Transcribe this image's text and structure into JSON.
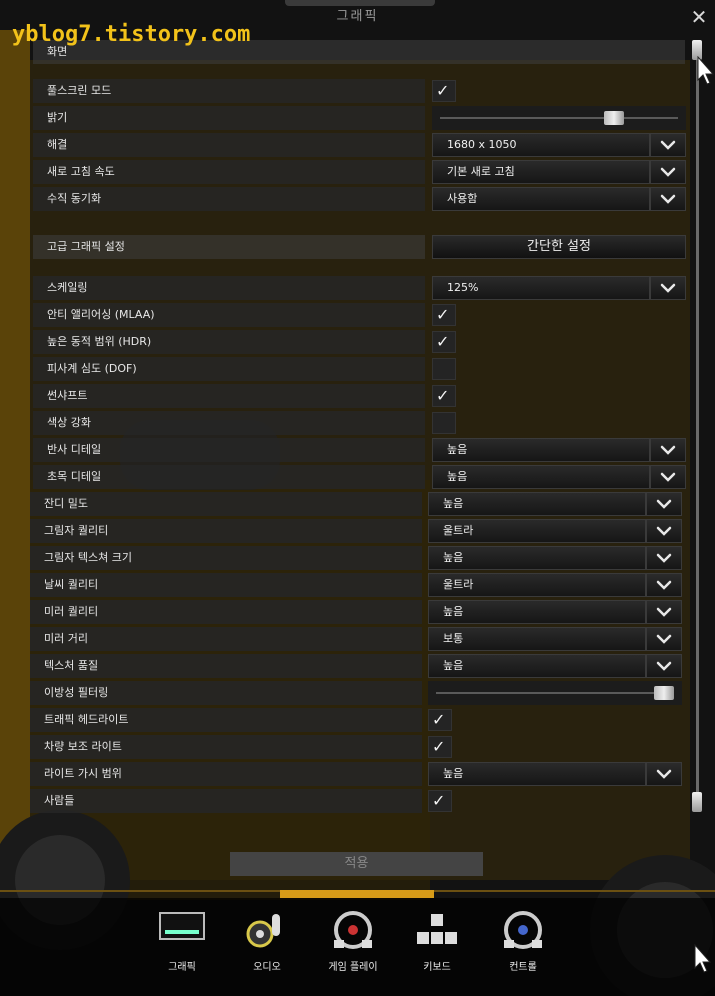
{
  "window": {
    "title": "그래픽",
    "close_glyph": "✕",
    "watermark": "yblog7.tistory.com"
  },
  "sections": {
    "screen": "화면",
    "advanced": "고급 그래픽 설정",
    "simple_button": "간단한 설정"
  },
  "screen_rows": [
    {
      "label": "풀스크린 모드",
      "type": "checkbox",
      "checked": true
    },
    {
      "label": "밝기",
      "type": "slider",
      "level": 0.75
    },
    {
      "label": "해결",
      "type": "dropdown",
      "value": "1680 x 1050"
    },
    {
      "label": "새로 고침 속도",
      "type": "dropdown",
      "value": "기본 새로 고침"
    },
    {
      "label": "수직 동기화",
      "type": "dropdown",
      "value": "사용함"
    }
  ],
  "advanced_rows": [
    {
      "label": "스케일링",
      "type": "dropdown",
      "value": "125%"
    },
    {
      "label": "안티 앨리어싱 (MLAA)",
      "type": "checkbox",
      "checked": true
    },
    {
      "label": "높은 동적 범위 (HDR)",
      "type": "checkbox",
      "checked": true
    },
    {
      "label": "피사계 심도 (DOF)",
      "type": "checkbox",
      "checked": false
    },
    {
      "label": "썬샤프트",
      "type": "checkbox",
      "checked": true
    },
    {
      "label": "색상 강화",
      "type": "checkbox",
      "checked": false
    },
    {
      "label": "반사 디테일",
      "type": "dropdown",
      "value": "높음"
    },
    {
      "label": "초목 디테일",
      "type": "dropdown",
      "value": "높음"
    }
  ],
  "lower_rows": [
    {
      "label": "잔디 밀도",
      "type": "dropdown",
      "value": "높음"
    },
    {
      "label": "그림자 퀄리티",
      "type": "dropdown",
      "value": "울트라"
    },
    {
      "label": "그림자 텍스쳐 크기",
      "type": "dropdown",
      "value": "높음"
    },
    {
      "label": "날씨 퀄리티",
      "type": "dropdown",
      "value": "울트라"
    },
    {
      "label": "미러 퀄리티",
      "type": "dropdown",
      "value": "높음"
    },
    {
      "label": "미러 거리",
      "type": "dropdown",
      "value": "보통"
    },
    {
      "label": "텍스처 품질",
      "type": "dropdown",
      "value": "높음"
    },
    {
      "label": "이방성 필터링",
      "type": "slider",
      "level": 1.0
    },
    {
      "label": "트래픽 헤드라이트",
      "type": "checkbox",
      "checked": true
    },
    {
      "label": "차량 보조 라이트",
      "type": "checkbox",
      "checked": true
    },
    {
      "label": "라이트 가시 범위",
      "type": "dropdown",
      "value": "높음"
    },
    {
      "label": "사람들",
      "type": "checkbox",
      "checked": true
    }
  ],
  "apply_label": "적용",
  "tabs": [
    {
      "label": "그래픽",
      "icon": "monitor-icon"
    },
    {
      "label": "오디오",
      "icon": "speaker-icon"
    },
    {
      "label": "게임 플레이",
      "icon": "steering-wheel-icon"
    },
    {
      "label": "키보드",
      "icon": "keyboard-icon"
    },
    {
      "label": "컨트롤",
      "icon": "controller-wheel-icon"
    }
  ],
  "colors": {
    "accent": "#d79b18",
    "watermark": "#f2c21a"
  }
}
